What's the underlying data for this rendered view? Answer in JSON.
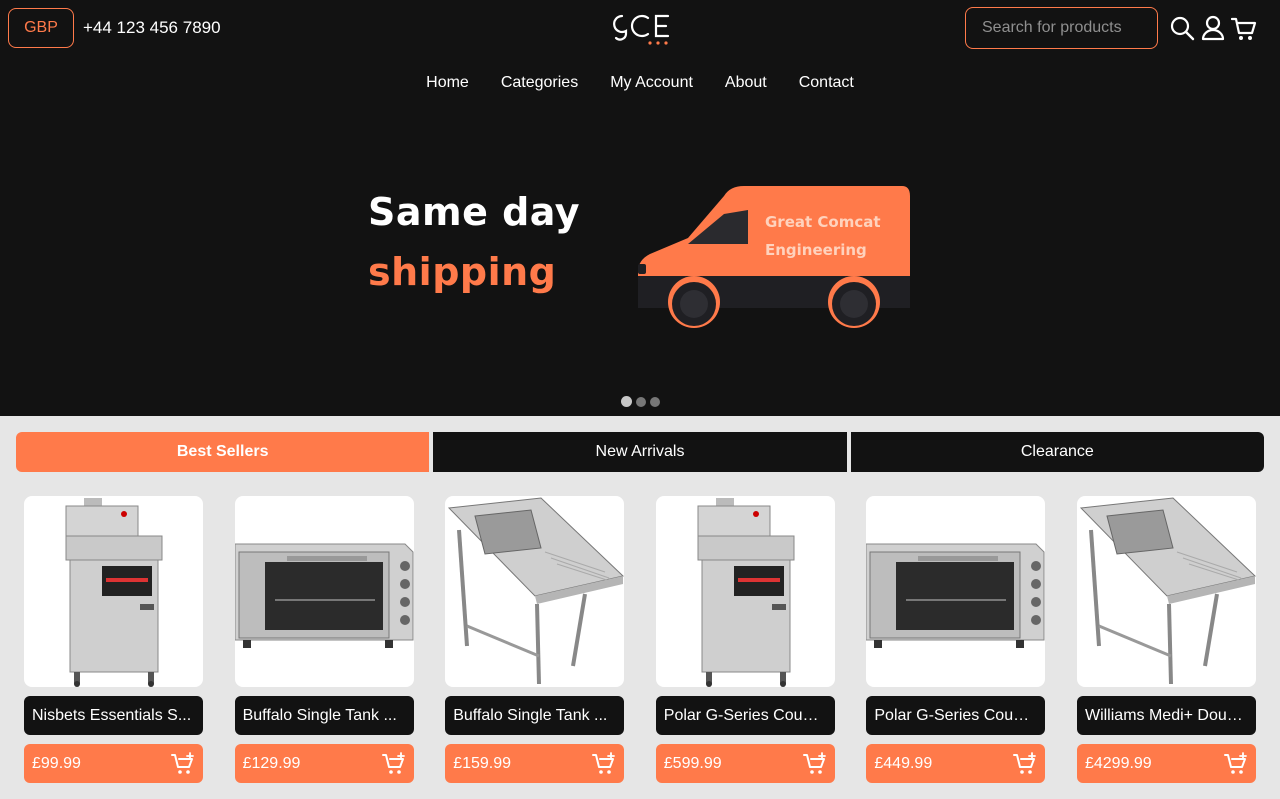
{
  "header": {
    "currency": "GBP",
    "phone": "+44 123 456 7890",
    "search_placeholder": "Search for products"
  },
  "nav": [
    "Home",
    "Categories",
    "My Account",
    "About",
    "Contact"
  ],
  "hero": {
    "line1": "Same day",
    "line2": "shipping",
    "van_line1": "Great Comcat",
    "van_line2": "Engineering",
    "slide_count": 3,
    "active_slide": 1
  },
  "tabs": [
    "Best Sellers",
    "New Arrivals",
    "Clearance"
  ],
  "active_tab": "Best Sellers",
  "products": [
    {
      "name": "Nisbets Essentials S...",
      "price": "£99.99",
      "image": "fryer"
    },
    {
      "name": "Buffalo Single Tank ...",
      "price": "£129.99",
      "image": "oven"
    },
    {
      "name": "Buffalo Single Tank ...",
      "price": "£159.99",
      "image": "sink"
    },
    {
      "name": "Polar G-Series Count...",
      "price": "£599.99",
      "image": "fryer"
    },
    {
      "name": "Polar G-Series Count...",
      "price": "£449.99",
      "image": "oven"
    },
    {
      "name": "Williams Medi+ Doubl...",
      "price": "£4299.99",
      "image": "sink"
    }
  ],
  "colors": {
    "accent": "#ff7a4a",
    "dark": "#121212",
    "bg": "#e6e6e6"
  }
}
